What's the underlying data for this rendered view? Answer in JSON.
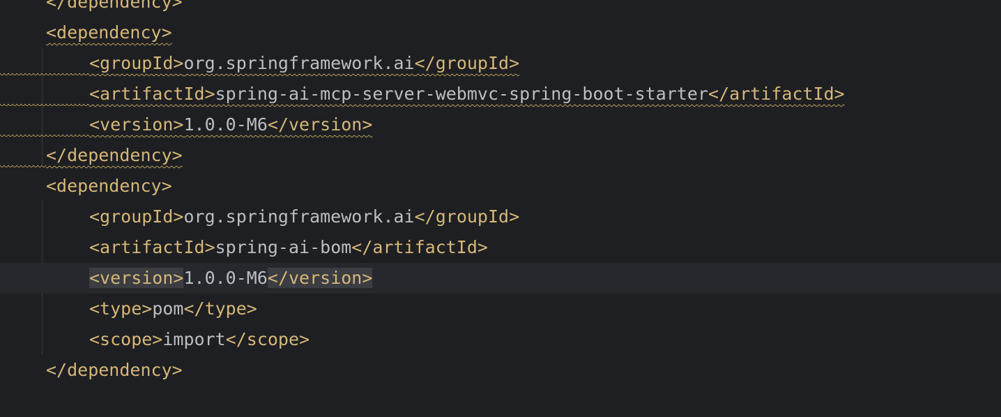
{
  "editor": {
    "lines": [
      {
        "parts": [
          {
            "t": "tag",
            "v": "</dependency>"
          }
        ],
        "indent": 1,
        "squiggle": false
      },
      {
        "parts": [
          {
            "t": "tag",
            "v": "<dependency>"
          }
        ],
        "indent": 1,
        "squiggle": true
      },
      {
        "parts": [
          {
            "t": "tag",
            "v": "<groupId>"
          },
          {
            "t": "txt",
            "v": "org.springframework.ai"
          },
          {
            "t": "tag",
            "v": "</groupId>"
          }
        ],
        "indent": 2,
        "squiggle": true
      },
      {
        "parts": [
          {
            "t": "tag",
            "v": "<artifactId>"
          },
          {
            "t": "txt",
            "v": "spring-ai-mcp-server-webmvc-spring-boot-starter"
          },
          {
            "t": "tag",
            "v": "</artifactId>"
          }
        ],
        "indent": 2,
        "squiggle": true
      },
      {
        "parts": [
          {
            "t": "tag",
            "v": "<version>"
          },
          {
            "t": "txt",
            "v": "1.0.0-M6"
          },
          {
            "t": "tag",
            "v": "</version>"
          }
        ],
        "indent": 2,
        "squiggle": true
      },
      {
        "parts": [
          {
            "t": "tag",
            "v": "</dependency>"
          }
        ],
        "indent": 1,
        "squiggle": true
      },
      {
        "parts": [
          {
            "t": "tag",
            "v": "<dependency>"
          }
        ],
        "indent": 1,
        "squiggle": false
      },
      {
        "parts": [
          {
            "t": "tag",
            "v": "<groupId>"
          },
          {
            "t": "txt",
            "v": "org.springframework.ai"
          },
          {
            "t": "tag",
            "v": "</groupId>"
          }
        ],
        "indent": 2,
        "squiggle": false
      },
      {
        "parts": [
          {
            "t": "tag",
            "v": "<artifactId>"
          },
          {
            "t": "txt",
            "v": "spring-ai-bom"
          },
          {
            "t": "tag",
            "v": "</artifactId>"
          }
        ],
        "indent": 2,
        "squiggle": false
      },
      {
        "parts": [
          {
            "t": "tag",
            "v": "<version>",
            "match": true
          },
          {
            "t": "txt",
            "v": "1.0.0-M6"
          },
          {
            "t": "tag",
            "v": "</version>",
            "match": true
          }
        ],
        "indent": 2,
        "squiggle": false,
        "current": true
      },
      {
        "parts": [
          {
            "t": "tag",
            "v": "<type>"
          },
          {
            "t": "txt",
            "v": "pom"
          },
          {
            "t": "tag",
            "v": "</type>"
          }
        ],
        "indent": 2,
        "squiggle": false
      },
      {
        "parts": [
          {
            "t": "tag",
            "v": "<scope>"
          },
          {
            "t": "txt",
            "v": "import"
          },
          {
            "t": "tag",
            "v": "</scope>"
          }
        ],
        "indent": 2,
        "squiggle": false
      },
      {
        "parts": [
          {
            "t": "tag",
            "v": "</dependency>"
          }
        ],
        "indent": 1,
        "squiggle": false
      }
    ]
  }
}
